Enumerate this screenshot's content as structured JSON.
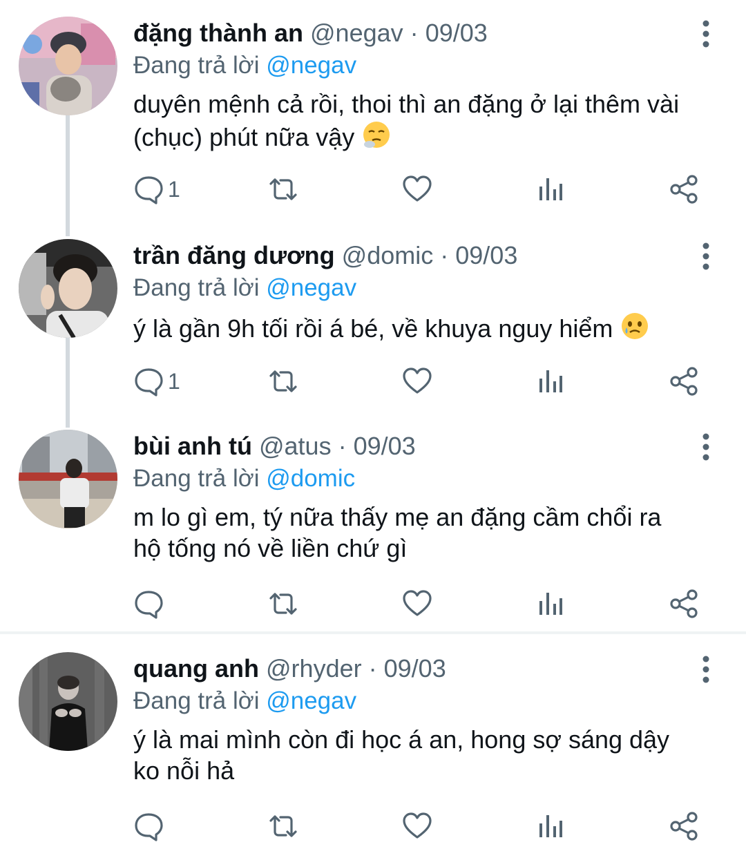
{
  "replying_label": "Đang trả lời",
  "tweets": [
    {
      "name": "đặng thành an",
      "handle": "@negav",
      "separator": "·",
      "date": "09/03",
      "reply_to": "@negav",
      "text_line1": "duyên mệnh cả rồi, thoi thì an đặng ở lại thêm vài",
      "text_line2": "(chục) phút nữa vậy",
      "emoji": "face-exhaling",
      "reply_count": "1"
    },
    {
      "name": "trần đăng dương",
      "handle": "@domic",
      "separator": "·",
      "date": "09/03",
      "reply_to": "@negav",
      "text_line1": "ý là gần 9h tối rồi á bé, về khuya nguy hiểm",
      "emoji": "face-holding-back-tears",
      "reply_count": "1"
    },
    {
      "name": "bùi anh tú",
      "handle": "@atus",
      "separator": "·",
      "date": "09/03",
      "reply_to": "@domic",
      "text_line1": "m lo gì em, tý nữa thấy mẹ an đặng cầm chổi ra",
      "text_line2": "hộ tống nó về liền chứ gì",
      "reply_count": ""
    },
    {
      "name": "quang anh",
      "handle": "@rhyder",
      "separator": "·",
      "date": "09/03",
      "reply_to": "@negav",
      "text_line1": "ý là mai mình còn đi học á an, hong sợ sáng dậy",
      "text_line2": "ko nỗi hả",
      "reply_count": ""
    }
  ],
  "colors": {
    "text": "#0f1419",
    "secondary": "#536471",
    "accent": "#1d9bf0",
    "icon": "#536471",
    "thread_line": "#d3d9de"
  },
  "icons": [
    "reply-icon",
    "retweet-icon",
    "like-icon",
    "views-icon",
    "share-icon",
    "more-options-icon"
  ]
}
